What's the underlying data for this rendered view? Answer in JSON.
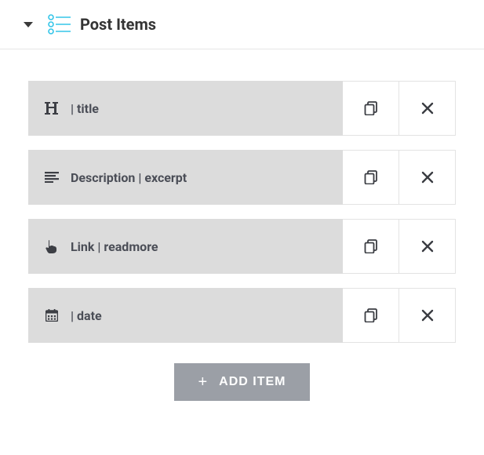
{
  "header": {
    "title": "Post Items"
  },
  "items": [
    {
      "icon": "heading",
      "label": "| title"
    },
    {
      "icon": "paragraph",
      "label": "Description | excerpt"
    },
    {
      "icon": "pointer",
      "label": "Link | readmore"
    },
    {
      "icon": "calendar",
      "label": "| date"
    }
  ],
  "addButton": {
    "label": "ADD ITEM"
  }
}
